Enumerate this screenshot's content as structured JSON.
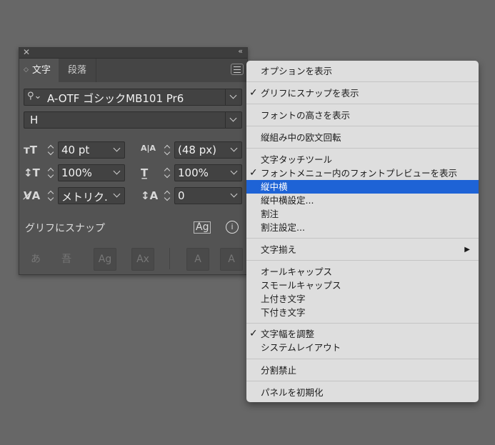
{
  "panel": {
    "tabs": [
      {
        "label": "文字"
      },
      {
        "label": "段落"
      }
    ],
    "font_family": "A-OTF ゴシックMB101 Pr6",
    "font_style": "H",
    "font_size": "40 pt",
    "leading": "(48 px)",
    "vertical_scale": "100%",
    "horizontal_scale": "100%",
    "kerning": "メトリク...",
    "tracking": "0",
    "glyph_snap_label": "グリフにスナップ",
    "bottom_icons": [
      {
        "icon": "あ",
        "name": "hiragana-icon"
      },
      {
        "icon": "吾",
        "name": "kanji-box-icon"
      },
      {
        "icon": "Ag",
        "name": "glyph-bounds-icon"
      },
      {
        "icon": "Ax",
        "name": "ax-icon"
      },
      {
        "icon": "A",
        "name": "angle-icon"
      },
      {
        "icon": "A",
        "name": "anchor-icon"
      }
    ]
  },
  "menu": {
    "items": [
      {
        "label": "オプションを表示",
        "checked": false
      },
      {
        "label": "グリフにスナップを表示",
        "checked": true
      },
      {
        "label": "フォントの高さを表示",
        "checked": false
      },
      {
        "label": "縦組み中の欧文回転",
        "checked": false
      },
      {
        "label": "文字タッチツール",
        "checked": false
      },
      {
        "label": "フォントメニュー内のフォントプレビューを表示",
        "checked": true
      },
      {
        "label": "縦中横",
        "checked": false,
        "highlighted": true
      },
      {
        "label": "縦中横設定...",
        "checked": false
      },
      {
        "label": "割注",
        "checked": false
      },
      {
        "label": "割注設定...",
        "checked": false
      },
      {
        "label": "文字揃え",
        "checked": false,
        "submenu": true
      },
      {
        "label": "オールキャップス",
        "checked": false
      },
      {
        "label": "スモールキャップス",
        "checked": false
      },
      {
        "label": "上付き文字",
        "checked": false
      },
      {
        "label": "下付き文字",
        "checked": false
      },
      {
        "label": "文字幅を調整",
        "checked": true
      },
      {
        "label": "システムレイアウト",
        "checked": false
      },
      {
        "label": "分割禁止",
        "checked": false
      },
      {
        "label": "パネルを初期化",
        "checked": false
      }
    ],
    "check_mark": "✓",
    "submenu_arrow": "▶"
  },
  "colors": {
    "highlight": "#1e63d6",
    "panel_bg": "#535353",
    "menu_bg": "#dedede"
  }
}
